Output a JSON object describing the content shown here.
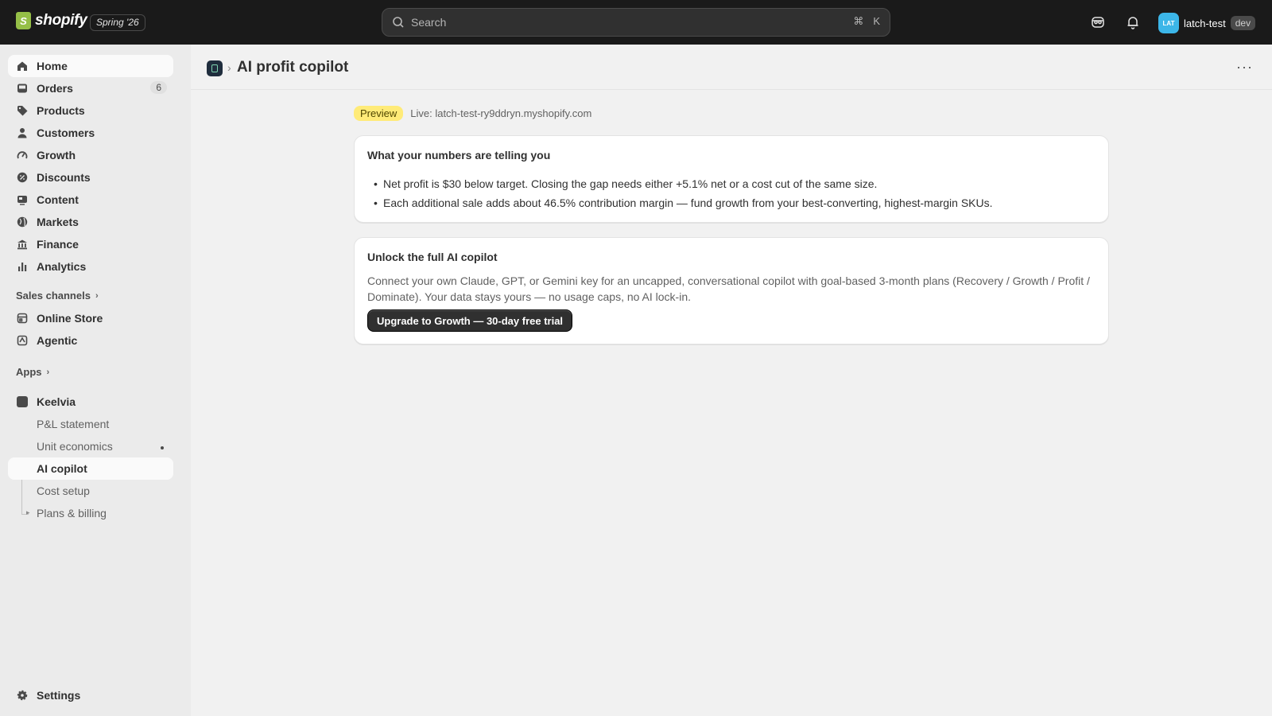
{
  "topbar": {
    "brand": "shopify",
    "brand_mark": "S",
    "edition": "Spring '26",
    "search_placeholder": "Search",
    "shortcut_cmd": "⌘",
    "shortcut_key": "K",
    "avatar_initials": "LAT",
    "username": "latch-test",
    "user_tag": "dev"
  },
  "sidebar": {
    "items": [
      {
        "label": "Home",
        "icon": "home-icon"
      },
      {
        "label": "Orders",
        "icon": "inbox-icon",
        "count": "6"
      },
      {
        "label": "Products",
        "icon": "tag-icon"
      },
      {
        "label": "Customers",
        "icon": "person-icon"
      },
      {
        "label": "Growth",
        "icon": "gauge-icon"
      },
      {
        "label": "Discounts",
        "icon": "discount-icon"
      },
      {
        "label": "Content",
        "icon": "content-icon"
      },
      {
        "label": "Markets",
        "icon": "globe-icon"
      },
      {
        "label": "Finance",
        "icon": "bank-icon"
      },
      {
        "label": "Analytics",
        "icon": "bar-chart-icon"
      }
    ],
    "sales_channels_label": "Sales channels",
    "channels": [
      {
        "label": "Online Store",
        "icon": "store-icon"
      },
      {
        "label": "Agentic",
        "icon": "agentic-icon"
      }
    ],
    "apps_label": "Apps",
    "app": {
      "label": "Keelvia",
      "icon": "app-icon"
    },
    "app_pages": [
      "P&L statement",
      "Unit economics",
      "AI copilot",
      "Cost setup",
      "Plans & billing"
    ],
    "settings_label": "Settings"
  },
  "header": {
    "title": "AI profit copilot",
    "more": "···"
  },
  "status": {
    "badge": "Preview",
    "live": "Live: latch-test-ry9ddryn.myshopify.com"
  },
  "insights": {
    "title": "What your numbers are telling you",
    "bullets": [
      "Net profit is $30 below target. Closing the gap needs either +5.1% net or a cost cut of the same size.",
      "Each additional sale adds about 46.5% contribution margin — fund growth from your best-converting, highest-margin SKUs."
    ]
  },
  "upgrade": {
    "title": "Unlock the full AI copilot",
    "body": "Connect your own Claude, GPT, or Gemini key for an uncapped, conversational copilot with goal-based 3-month plans (Recovery / Growth / Profit / Dominate). Your data stays yours — no usage caps, no AI lock-in.",
    "button": "Upgrade to Growth — 30-day free trial"
  },
  "colors": {
    "topbar_bg": "#1a1a1a",
    "page_bg": "#f1f1f1",
    "sidebar_bg": "#ebebeb",
    "preview_badge": "#ffeb78",
    "primary_button": "#303030"
  }
}
